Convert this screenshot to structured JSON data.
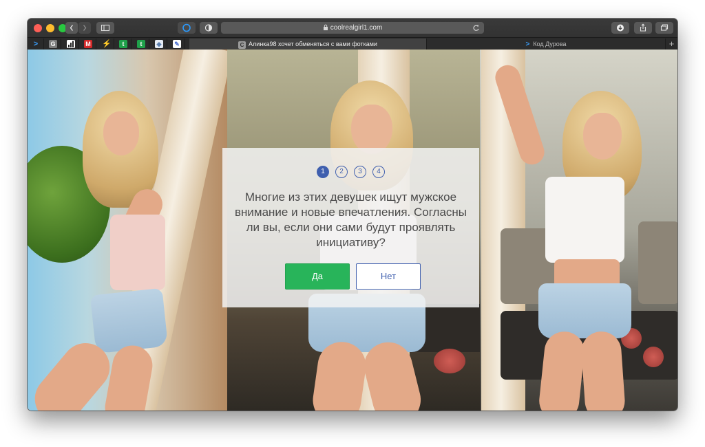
{
  "toolbar": {
    "url": "coolrealgirl1.com"
  },
  "tabs": {
    "active": {
      "favicon_letter": "C",
      "title": "Алинка98 хочет обменяться с вами фотками"
    },
    "inactive": {
      "title": "Код Дурова"
    },
    "pinned": [
      {
        "name": "prompt",
        "glyph": ">",
        "color": "#3aa0ff"
      },
      {
        "name": "google",
        "glyph": "G",
        "color": "#7d7d7d"
      },
      {
        "name": "stats",
        "glyph": "▮",
        "color": "#ffffff"
      },
      {
        "name": "mail",
        "glyph": "M",
        "color": "#d42a2a"
      },
      {
        "name": "bolt",
        "glyph": "⚡",
        "color": "#f0c419"
      },
      {
        "name": "green-t-1",
        "glyph": "t",
        "color": "#1fa04a"
      },
      {
        "name": "green-t-2",
        "glyph": "t",
        "color": "#1fa04a"
      },
      {
        "name": "shield",
        "glyph": "◆",
        "color": "#5b7fae"
      },
      {
        "name": "tool",
        "glyph": "✎",
        "color": "#4a6fd1"
      }
    ]
  },
  "quiz": {
    "steps": [
      "1",
      "2",
      "3",
      "4"
    ],
    "active_step": 1,
    "question": "Многие из этих девушек ищут мужское внимание и новые впечатления. Согласны ли вы, если они сами будут проявлять инициативу?",
    "yes_label": "Да",
    "no_label": "Нет"
  },
  "colors": {
    "accent_blue": "#3f5fae",
    "yes_green": "#28b45a"
  }
}
